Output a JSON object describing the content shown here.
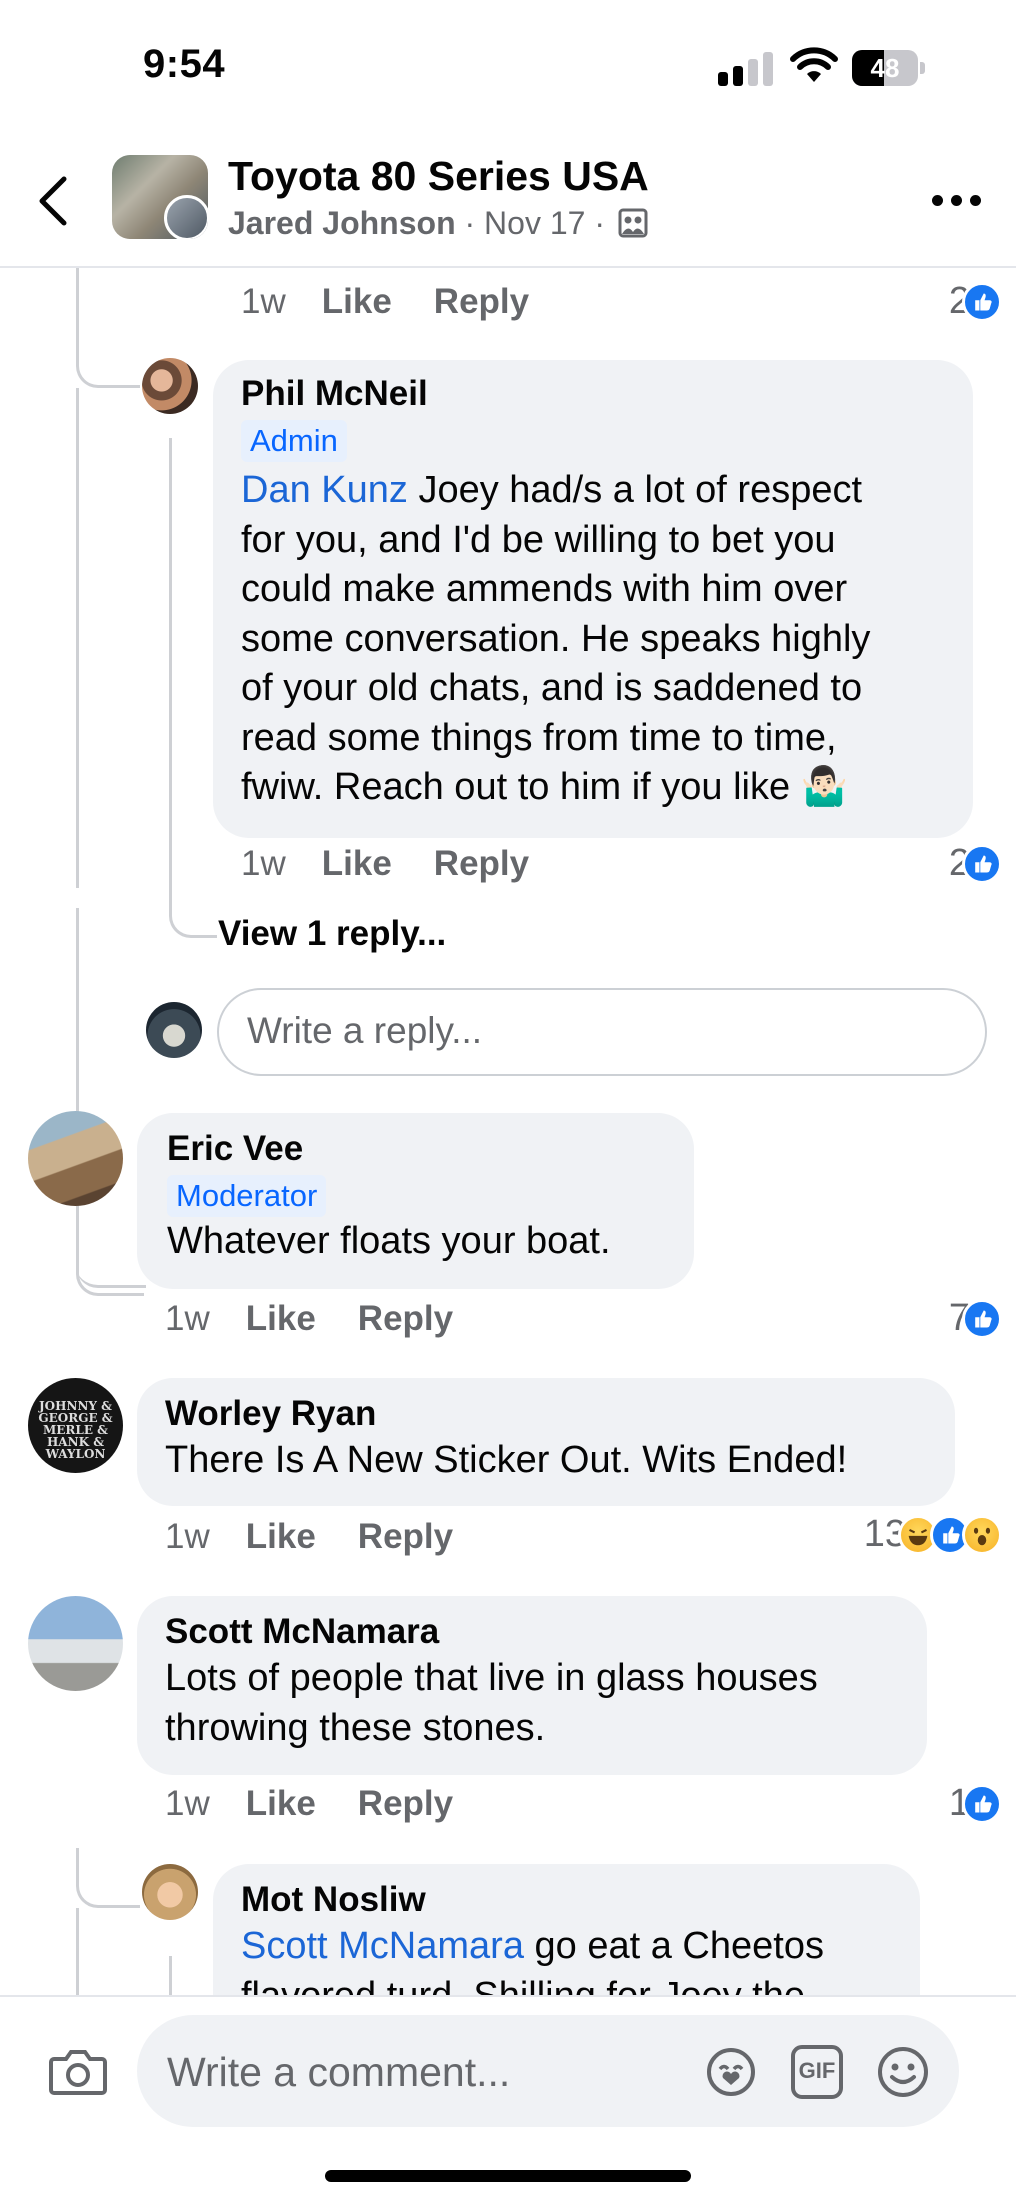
{
  "status_bar": {
    "time": "9:54",
    "battery": "48",
    "battery_level": 0.48,
    "signal_bars_active": 2
  },
  "header": {
    "group_name": "Toyota 80 Series USA",
    "author": "Jared Johnson",
    "separator": "·",
    "date": "Nov 17",
    "back_icon": "chevron-left-icon",
    "privacy_icon": "group-privacy-icon",
    "more_icon": "more-horizontal-icon"
  },
  "prev_comment_actions": {
    "ago": "1w",
    "like": "Like",
    "reply": "Reply",
    "reaction_count": "2"
  },
  "comments": [
    {
      "name": "Phil McNeil",
      "role": "Admin",
      "mention": "Dan Kunz",
      "text_lines": [
        " Joey had/s a lot of respect",
        "for you, and I'd be willing to bet you",
        "could make ammends with him over",
        "some conversation. He speaks highly",
        "of your old chats, and is saddened to",
        "read some things from time to time,",
        "fwiw. Reach out to him if you like 🤷🏻‍♂️"
      ],
      "ago": "1w",
      "like": "Like",
      "reply": "Reply",
      "reaction_count": "2",
      "view_replies": "View 1 reply..."
    },
    {
      "name": "Eric Vee",
      "role": "Moderator",
      "text": "Whatever floats your boat.",
      "ago": "1w",
      "like": "Like",
      "reply": "Reply",
      "reaction_count": "7"
    },
    {
      "name": "Worley Ryan",
      "text": "There Is A New Sticker Out. Wits Ended!",
      "ago": "1w",
      "like": "Like",
      "reply": "Reply",
      "reaction_count": "13",
      "avatar_text": [
        "JOHNNY &",
        "GEORGE &",
        "MERLE &",
        "HANK &",
        "WAYLON"
      ]
    },
    {
      "name": "Scott McNamara",
      "text_lines": [
        "Lots of people that live in glass houses",
        "throwing these stones."
      ],
      "ago": "1w",
      "like": "Like",
      "reply": "Reply",
      "reaction_count": "1"
    },
    {
      "name": "Mot Nosliw",
      "mention": "Scott McNamara",
      "text_lines": [
        " go eat a Cheetos",
        "flavored turd. Shilling for Joey the"
      ]
    }
  ],
  "reply_input": {
    "placeholder": "Write a reply..."
  },
  "composer": {
    "placeholder": "Write a comment...",
    "camera_icon": "camera-icon",
    "avatar_icon": "avatar-sticker-icon",
    "gif_label": "GIF",
    "emoji_icon": "emoji-icon"
  },
  "colors": {
    "accent": "#1877f2",
    "mention": "#1b66d6",
    "bubble": "#f0f2f5",
    "muted": "#65676b"
  }
}
